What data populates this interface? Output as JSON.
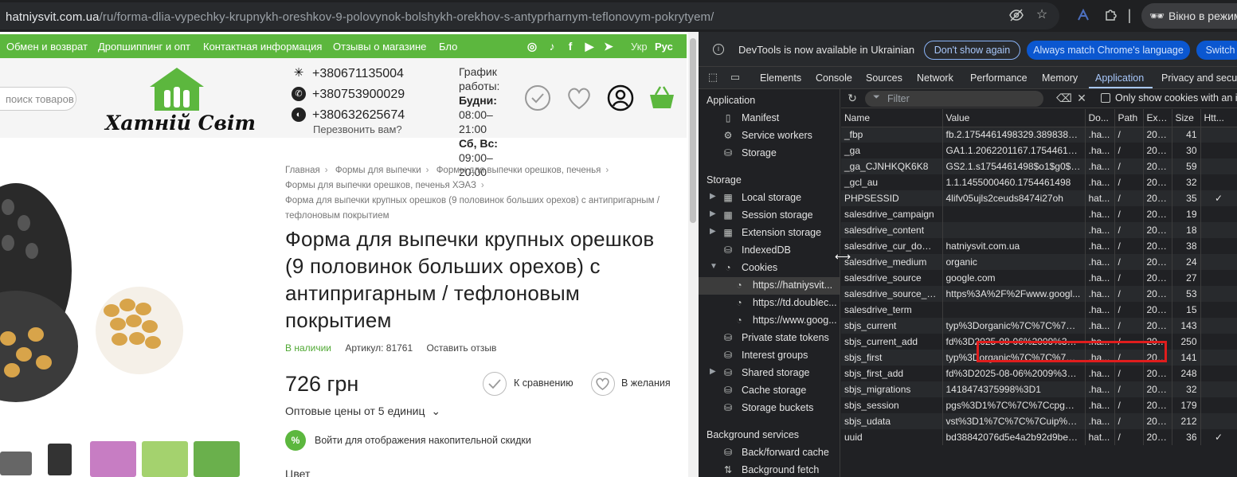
{
  "browser": {
    "url_host": "hatniysvit.com.ua",
    "url_path": "/ru/forma-dlia-vypechky-krupnykh-oreshkov-9-polovynok-bolshykh-orekhov-s-antyprharnym-teflonovym-pokrytyem/",
    "incognito_label": "Вікно в режимі"
  },
  "site": {
    "nav": [
      "Обмен и возврат",
      "Дропшиппинг и опт",
      "Контактная информация",
      "Отзывы о магазине",
      "Бло"
    ],
    "lang": [
      "Укр",
      "Рус"
    ],
    "search_placeholder": "поиск товаров",
    "logo_text": "Хатній Світ",
    "phones": [
      "+380671135004",
      "+380753900029",
      "+380632625674"
    ],
    "callback": "Перезвонить вам?",
    "schedule": {
      "title": "График работы:",
      "weekdays_label": "Будни:",
      "weekdays_hours": "08:00–21:00",
      "weekend_label": "Сб, Вс:",
      "weekend_hours": "09:00–20:00"
    },
    "breadcrumbs": [
      "Главная",
      "Формы для выпечки",
      "Формы для выпечки орешков, печенья",
      "Формы для выпечки орешков, печенья ХЭАЗ",
      "Форма для выпечки крупных орешков (9 половинок больших орехов) с антипригарным / тефлоновым покрытием"
    ],
    "product": {
      "title": "Форма для выпечки крупных орешков (9 половинок больших орехов) с антипригарным / тефлоновым покрытием",
      "availability": "В наличии",
      "sku": "Артикул: 81761",
      "review_link": "Оставить отзыв",
      "price": "726 грн",
      "wholesale": "Оптовые цены от 5 единиц",
      "compare": "К сравнению",
      "wishlist": "В желания",
      "discount_text": "Войти для отображения накопительной скидки",
      "discount_badge": "%",
      "color_label": "Цвет"
    },
    "brand_color": "#5cb73e"
  },
  "devtools": {
    "infobar": {
      "message": "DevTools is now available in Ukrainian",
      "dont_show": "Don't show again",
      "match_lang": "Always match Chrome's language",
      "switch": "Switch"
    },
    "tabs": [
      "Elements",
      "Console",
      "Sources",
      "Network",
      "Performance",
      "Memory",
      "Application",
      "Privacy and secur"
    ],
    "active_tab": "Application",
    "sidebar": {
      "application_header": "Application",
      "application_items": [
        "Manifest",
        "Service workers",
        "Storage"
      ],
      "storage_header": "Storage",
      "storage_items": [
        "Local storage",
        "Session storage",
        "Extension storage",
        "IndexedDB",
        "Cookies"
      ],
      "cookie_origins": [
        "https://hatniysvit...",
        "https://td.doublec...",
        "https://www.goog..."
      ],
      "more_items": [
        "Private state tokens",
        "Interest groups",
        "Shared storage",
        "Cache storage",
        "Storage buckets"
      ],
      "bg_header": "Background services",
      "bg_items": [
        "Back/forward cache",
        "Background fetch"
      ]
    },
    "filter_placeholder": "Filter",
    "only_show_label": "Only show cookies with an is",
    "columns": [
      "Name",
      "Value",
      "Do...",
      "Path",
      "Exp...",
      "Size",
      "Htt..."
    ],
    "rows": [
      [
        "_fbp",
        "fb.2.1754461498329.38983861...",
        ".ha...",
        "/",
        "202...",
        "41",
        ""
      ],
      [
        "_ga",
        "GA1.1.2062201167.1754461498",
        ".ha...",
        "/",
        "202...",
        "30",
        ""
      ],
      [
        "_ga_CJNHKQK6K8",
        "GS2.1.s1754461498$o1$g0$t1...",
        ".ha...",
        "/",
        "202...",
        "59",
        ""
      ],
      [
        "_gcl_au",
        "1.1.1455000460.1754461498",
        ".ha...",
        "/",
        "202...",
        "32",
        ""
      ],
      [
        "PHPSESSID",
        "4lifv05ujls2ceuds8474i27oh",
        "hat...",
        "/",
        "202...",
        "35",
        "✓"
      ],
      [
        "salesdrive_campaign",
        "",
        ".ha...",
        "/",
        "202...",
        "19",
        ""
      ],
      [
        "salesdrive_content",
        "",
        ".ha...",
        "/",
        "202...",
        "18",
        ""
      ],
      [
        "salesdrive_cur_doma...",
        "hatniysvit.com.ua",
        ".ha...",
        "/",
        "202...",
        "38",
        ""
      ],
      [
        "salesdrive_medium",
        "organic",
        ".ha...",
        "/",
        "202...",
        "24",
        ""
      ],
      [
        "salesdrive_source",
        "google.com",
        ".ha...",
        "/",
        "202...",
        "27",
        ""
      ],
      [
        "salesdrive_source_full",
        "https%3A%2F%2Fwww.googl...",
        ".ha...",
        "/",
        "202...",
        "53",
        ""
      ],
      [
        "salesdrive_term",
        "",
        ".ha...",
        "/",
        "202...",
        "15",
        ""
      ],
      [
        "sbjs_current",
        "typ%3Dorganic%7C%7C%7Cs...",
        ".ha...",
        "/",
        "202...",
        "143",
        ""
      ],
      [
        "sbjs_current_add",
        "fd%3D2025-08-06%2009%3A...",
        ".ha...",
        "/",
        "202...",
        "250",
        ""
      ],
      [
        "sbjs_first",
        "typ%3Dorganic%7C%7C%7Cs...",
        ".ha...",
        "/",
        "202...",
        "141",
        ""
      ],
      [
        "sbjs_first_add",
        "fd%3D2025-08-06%2009%3A...",
        ".ha...",
        "/",
        "202...",
        "248",
        ""
      ],
      [
        "sbjs_migrations",
        "1418474375998%3D1",
        ".ha...",
        "/",
        "202...",
        "32",
        ""
      ],
      [
        "sbjs_session",
        "pgs%3D1%7C%7C%7Ccpg%3...",
        ".ha...",
        "/",
        "202...",
        "179",
        ""
      ],
      [
        "sbjs_udata",
        "vst%3D1%7C%7C%7Cuip%3D...",
        ".ha...",
        "/",
        "202...",
        "212",
        ""
      ],
      [
        "uuid",
        "bd38842076d5e4a2b92d9be4...",
        "hat...",
        "/",
        "202...",
        "36",
        "✓"
      ]
    ],
    "accent": "#a8c7fa",
    "highlight_color": "#e01d1d"
  }
}
